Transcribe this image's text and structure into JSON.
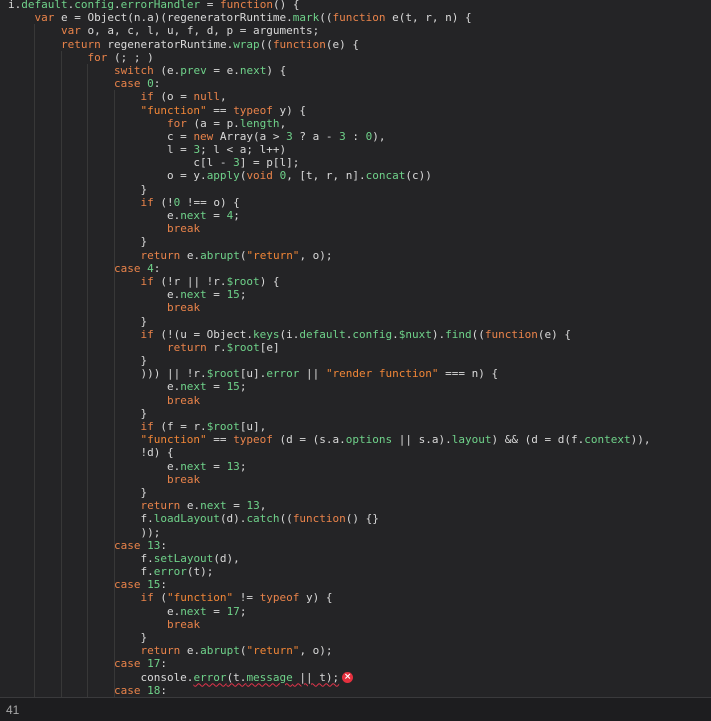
{
  "editor": {
    "lines": [
      [
        {
          "t": "i."
        },
        {
          "t": "default",
          "c": "p"
        },
        {
          "t": "."
        },
        {
          "t": "config",
          "c": "p"
        },
        {
          "t": "."
        },
        {
          "t": "errorHandler",
          "c": "p"
        },
        {
          "t": " = "
        },
        {
          "t": "function",
          "c": "k"
        },
        {
          "t": "() {"
        }
      ],
      [
        {
          "t": "    "
        },
        {
          "t": "var",
          "c": "k"
        },
        {
          "t": " e = Object(n.a)(regeneratorRuntime."
        },
        {
          "t": "mark",
          "c": "m"
        },
        {
          "t": "(("
        },
        {
          "t": "function",
          "c": "k"
        },
        {
          "t": " e(t, r, n) {"
        }
      ],
      [
        {
          "t": "        "
        },
        {
          "t": "var",
          "c": "k"
        },
        {
          "t": " o, a, c, l, u, f, d, p = arguments;"
        }
      ],
      [
        {
          "t": "        "
        },
        {
          "t": "return",
          "c": "k"
        },
        {
          "t": " regeneratorRuntime."
        },
        {
          "t": "wrap",
          "c": "m"
        },
        {
          "t": "(("
        },
        {
          "t": "function",
          "c": "k"
        },
        {
          "t": "(e) {"
        }
      ],
      [
        {
          "t": "            "
        },
        {
          "t": "for",
          "c": "k"
        },
        {
          "t": " (; ; )"
        }
      ],
      [
        {
          "t": "                "
        },
        {
          "t": "switch",
          "c": "k"
        },
        {
          "t": " (e."
        },
        {
          "t": "prev",
          "c": "p"
        },
        {
          "t": " = e."
        },
        {
          "t": "next",
          "c": "p"
        },
        {
          "t": ") {"
        }
      ],
      [
        {
          "t": "                "
        },
        {
          "t": "case",
          "c": "k"
        },
        {
          "t": " "
        },
        {
          "t": "0",
          "c": "n"
        },
        {
          "t": ":"
        }
      ],
      [
        {
          "t": "                    "
        },
        {
          "t": "if",
          "c": "k"
        },
        {
          "t": " (o = "
        },
        {
          "t": "null",
          "c": "k"
        },
        {
          "t": ","
        }
      ],
      [
        {
          "t": "                    "
        },
        {
          "t": "\"function\"",
          "c": "s"
        },
        {
          "t": " == "
        },
        {
          "t": "typeof",
          "c": "k"
        },
        {
          "t": " y) {"
        }
      ],
      [
        {
          "t": "                        "
        },
        {
          "t": "for",
          "c": "k"
        },
        {
          "t": " (a = p."
        },
        {
          "t": "length",
          "c": "p"
        },
        {
          "t": ","
        }
      ],
      [
        {
          "t": "                        c = "
        },
        {
          "t": "new",
          "c": "k"
        },
        {
          "t": " Array(a > "
        },
        {
          "t": "3",
          "c": "n"
        },
        {
          "t": " ? a - "
        },
        {
          "t": "3",
          "c": "n"
        },
        {
          "t": " : "
        },
        {
          "t": "0",
          "c": "n"
        },
        {
          "t": "),"
        }
      ],
      [
        {
          "t": "                        l = "
        },
        {
          "t": "3",
          "c": "n"
        },
        {
          "t": "; l < a; l++)"
        }
      ],
      [
        {
          "t": "                            c[l - "
        },
        {
          "t": "3",
          "c": "n"
        },
        {
          "t": "] = p[l];"
        }
      ],
      [
        {
          "t": "                        o = y."
        },
        {
          "t": "apply",
          "c": "m"
        },
        {
          "t": "("
        },
        {
          "t": "void",
          "c": "k"
        },
        {
          "t": " "
        },
        {
          "t": "0",
          "c": "n"
        },
        {
          "t": ", [t, r, n]."
        },
        {
          "t": "concat",
          "c": "m"
        },
        {
          "t": "(c))"
        }
      ],
      [
        {
          "t": "                    }"
        }
      ],
      [
        {
          "t": "                    "
        },
        {
          "t": "if",
          "c": "k"
        },
        {
          "t": " (!"
        },
        {
          "t": "0",
          "c": "n"
        },
        {
          "t": " !== o) {"
        }
      ],
      [
        {
          "t": "                        e."
        },
        {
          "t": "next",
          "c": "p"
        },
        {
          "t": " = "
        },
        {
          "t": "4",
          "c": "n"
        },
        {
          "t": ";"
        }
      ],
      [
        {
          "t": "                        "
        },
        {
          "t": "break",
          "c": "k"
        }
      ],
      [
        {
          "t": "                    }"
        }
      ],
      [
        {
          "t": "                    "
        },
        {
          "t": "return",
          "c": "k"
        },
        {
          "t": " e."
        },
        {
          "t": "abrupt",
          "c": "m"
        },
        {
          "t": "("
        },
        {
          "t": "\"return\"",
          "c": "s"
        },
        {
          "t": ", o);"
        }
      ],
      [
        {
          "t": "                "
        },
        {
          "t": "case",
          "c": "k"
        },
        {
          "t": " "
        },
        {
          "t": "4",
          "c": "n"
        },
        {
          "t": ":"
        }
      ],
      [
        {
          "t": "                    "
        },
        {
          "t": "if",
          "c": "k"
        },
        {
          "t": " (!r || !r."
        },
        {
          "t": "$root",
          "c": "p"
        },
        {
          "t": ") {"
        }
      ],
      [
        {
          "t": "                        e."
        },
        {
          "t": "next",
          "c": "p"
        },
        {
          "t": " = "
        },
        {
          "t": "15",
          "c": "n"
        },
        {
          "t": ";"
        }
      ],
      [
        {
          "t": "                        "
        },
        {
          "t": "break",
          "c": "k"
        }
      ],
      [
        {
          "t": "                    }"
        }
      ],
      [
        {
          "t": "                    "
        },
        {
          "t": "if",
          "c": "k"
        },
        {
          "t": " (!(u = Object."
        },
        {
          "t": "keys",
          "c": "m"
        },
        {
          "t": "(i."
        },
        {
          "t": "default",
          "c": "p"
        },
        {
          "t": "."
        },
        {
          "t": "config",
          "c": "p"
        },
        {
          "t": "."
        },
        {
          "t": "$nuxt",
          "c": "p"
        },
        {
          "t": ")."
        },
        {
          "t": "find",
          "c": "m"
        },
        {
          "t": "(("
        },
        {
          "t": "function",
          "c": "k"
        },
        {
          "t": "(e) {"
        }
      ],
      [
        {
          "t": "                        "
        },
        {
          "t": "return",
          "c": "k"
        },
        {
          "t": " r."
        },
        {
          "t": "$root",
          "c": "p"
        },
        {
          "t": "[e]"
        }
      ],
      [
        {
          "t": "                    }"
        }
      ],
      [
        {
          "t": "                    ))) || !r."
        },
        {
          "t": "$root",
          "c": "p"
        },
        {
          "t": "[u]."
        },
        {
          "t": "error",
          "c": "p"
        },
        {
          "t": " || "
        },
        {
          "t": "\"render function\"",
          "c": "s"
        },
        {
          "t": " === n) {"
        }
      ],
      [
        {
          "t": "                        e."
        },
        {
          "t": "next",
          "c": "p"
        },
        {
          "t": " = "
        },
        {
          "t": "15",
          "c": "n"
        },
        {
          "t": ";"
        }
      ],
      [
        {
          "t": "                        "
        },
        {
          "t": "break",
          "c": "k"
        }
      ],
      [
        {
          "t": "                    }"
        }
      ],
      [
        {
          "t": "                    "
        },
        {
          "t": "if",
          "c": "k"
        },
        {
          "t": " (f = r."
        },
        {
          "t": "$root",
          "c": "p"
        },
        {
          "t": "[u],"
        }
      ],
      [
        {
          "t": "                    "
        },
        {
          "t": "\"function\"",
          "c": "s"
        },
        {
          "t": " == "
        },
        {
          "t": "typeof",
          "c": "k"
        },
        {
          "t": " (d = (s.a."
        },
        {
          "t": "options",
          "c": "p"
        },
        {
          "t": " || s.a)."
        },
        {
          "t": "layout",
          "c": "p"
        },
        {
          "t": ") && (d = d(f."
        },
        {
          "t": "context",
          "c": "p"
        },
        {
          "t": ")),"
        }
      ],
      [
        {
          "t": "                    !d) {"
        }
      ],
      [
        {
          "t": "                        e."
        },
        {
          "t": "next",
          "c": "p"
        },
        {
          "t": " = "
        },
        {
          "t": "13",
          "c": "n"
        },
        {
          "t": ";"
        }
      ],
      [
        {
          "t": "                        "
        },
        {
          "t": "break",
          "c": "k"
        }
      ],
      [
        {
          "t": "                    }"
        }
      ],
      [
        {
          "t": "                    "
        },
        {
          "t": "return",
          "c": "k"
        },
        {
          "t": " e."
        },
        {
          "t": "next",
          "c": "p"
        },
        {
          "t": " = "
        },
        {
          "t": "13",
          "c": "n"
        },
        {
          "t": ","
        }
      ],
      [
        {
          "t": "                    f."
        },
        {
          "t": "loadLayout",
          "c": "m"
        },
        {
          "t": "(d)."
        },
        {
          "t": "catch",
          "c": "m"
        },
        {
          "t": "(("
        },
        {
          "t": "function",
          "c": "k"
        },
        {
          "t": "() {}"
        }
      ],
      [
        {
          "t": "                    ));"
        }
      ],
      [
        {
          "t": "                "
        },
        {
          "t": "case",
          "c": "k"
        },
        {
          "t": " "
        },
        {
          "t": "13",
          "c": "n"
        },
        {
          "t": ":"
        }
      ],
      [
        {
          "t": "                    f."
        },
        {
          "t": "setLayout",
          "c": "m"
        },
        {
          "t": "(d),"
        }
      ],
      [
        {
          "t": "                    f."
        },
        {
          "t": "error",
          "c": "m"
        },
        {
          "t": "(t);"
        }
      ],
      [
        {
          "t": "                "
        },
        {
          "t": "case",
          "c": "k"
        },
        {
          "t": " "
        },
        {
          "t": "15",
          "c": "n"
        },
        {
          "t": ":"
        }
      ],
      [
        {
          "t": "                    "
        },
        {
          "t": "if",
          "c": "k"
        },
        {
          "t": " ("
        },
        {
          "t": "\"function\"",
          "c": "s"
        },
        {
          "t": " != "
        },
        {
          "t": "typeof",
          "c": "k"
        },
        {
          "t": " y) {"
        }
      ],
      [
        {
          "t": "                        e."
        },
        {
          "t": "next",
          "c": "p"
        },
        {
          "t": " = "
        },
        {
          "t": "17",
          "c": "n"
        },
        {
          "t": ";"
        }
      ],
      [
        {
          "t": "                        "
        },
        {
          "t": "break",
          "c": "k"
        }
      ],
      [
        {
          "t": "                    }"
        }
      ],
      [
        {
          "t": "                    "
        },
        {
          "t": "return",
          "c": "k"
        },
        {
          "t": " e."
        },
        {
          "t": "abrupt",
          "c": "m"
        },
        {
          "t": "("
        },
        {
          "t": "\"return\"",
          "c": "s"
        },
        {
          "t": ", o);"
        }
      ],
      [
        {
          "t": "                "
        },
        {
          "t": "case",
          "c": "k"
        },
        {
          "t": " "
        },
        {
          "t": "17",
          "c": "n"
        },
        {
          "t": ":"
        }
      ],
      [
        {
          "t": "                    console."
        },
        {
          "t": "error",
          "c": "m",
          "err": true
        },
        {
          "t": "(t.",
          "err": true
        },
        {
          "t": "message",
          "c": "p",
          "err": true
        },
        {
          "t": " || t);",
          "err": true
        },
        {
          "icon": "error-icon"
        }
      ],
      [
        {
          "t": "                "
        },
        {
          "t": "case",
          "c": "k"
        },
        {
          "t": " "
        },
        {
          "t": "18",
          "c": "n"
        },
        {
          "t": ":"
        }
      ]
    ]
  },
  "status": {
    "line_number": "41"
  },
  "colors": {
    "background": "#242426",
    "keyword": "#e9834a",
    "string": "#f18637",
    "number": "#6fd28a",
    "error": "#e5303e"
  }
}
